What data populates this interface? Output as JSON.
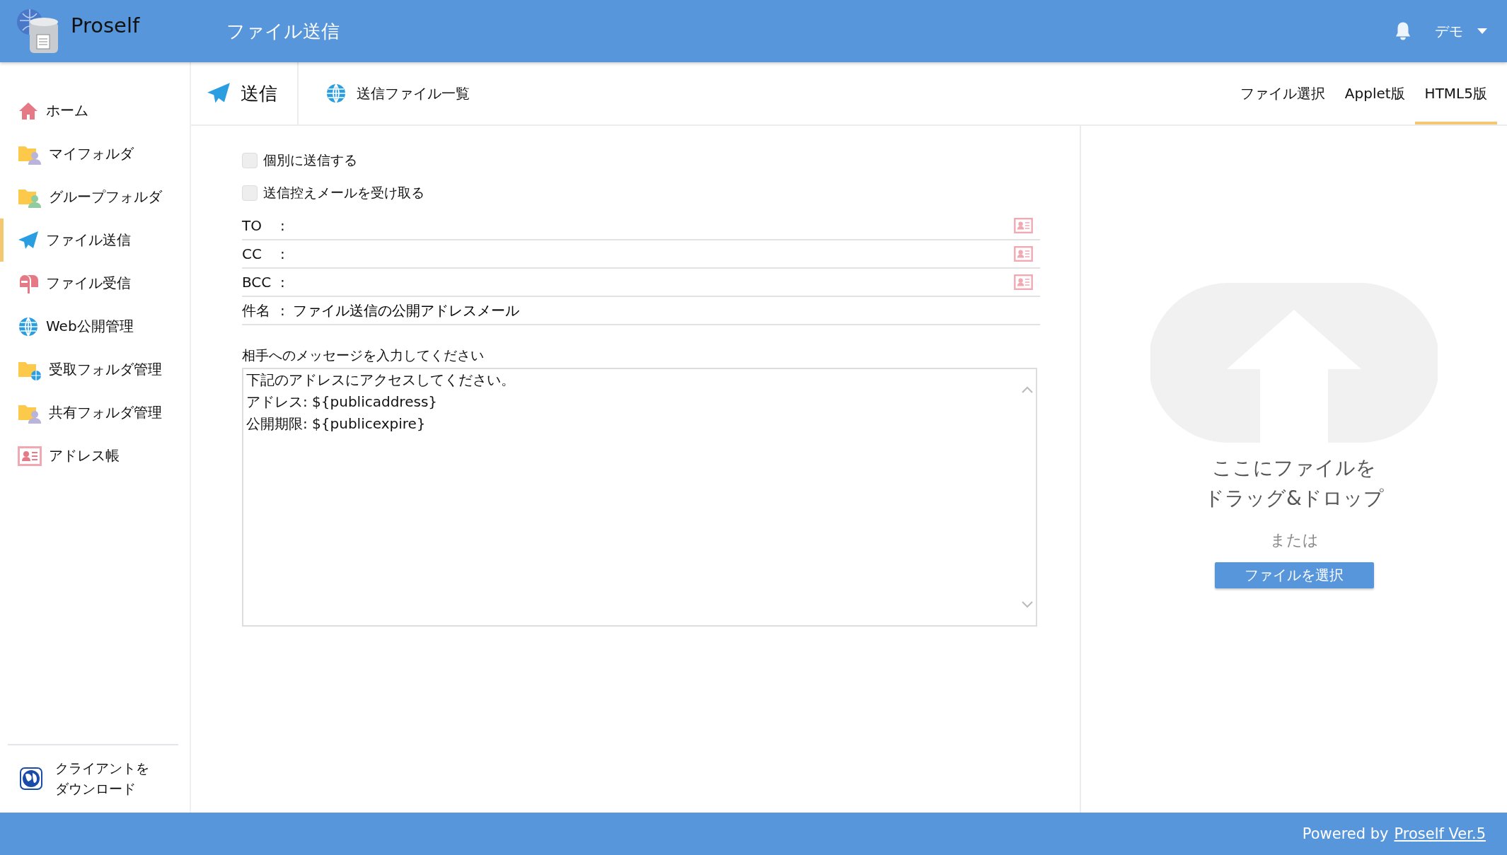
{
  "header": {
    "logo_text": "Proself",
    "title": "ファイル送信",
    "user": "デモ"
  },
  "sidebar": {
    "items": [
      {
        "label": "ホーム",
        "kind": "home",
        "selected": false
      },
      {
        "label": "マイフォルダ",
        "kind": "myfolder",
        "selected": false
      },
      {
        "label": "グループフォルダ",
        "kind": "groupfolder",
        "selected": false
      },
      {
        "label": "ファイル送信",
        "kind": "send",
        "selected": true
      },
      {
        "label": "ファイル受信",
        "kind": "receive",
        "selected": false
      },
      {
        "label": "Web公開管理",
        "kind": "web",
        "selected": false
      },
      {
        "label": "受取フォルダ管理",
        "kind": "receivefolder",
        "selected": false
      },
      {
        "label": "共有フォルダ管理",
        "kind": "sharedfolder",
        "selected": false
      },
      {
        "label": "アドレス帳",
        "kind": "addressbook",
        "selected": false
      }
    ],
    "download": [
      "クライアントを",
      "ダウンロード"
    ]
  },
  "subtabs": [
    {
      "label": "送信",
      "kind": "send",
      "selected": true
    },
    {
      "label": "送信ファイル一覧",
      "kind": "list",
      "selected": false
    }
  ],
  "mode_tabs": [
    {
      "label": "ファイル選択",
      "selected": false
    },
    {
      "label": "Applet版",
      "selected": false
    },
    {
      "label": "HTML5版",
      "selected": true
    }
  ],
  "form": {
    "options": [
      {
        "label": "個別に送信する",
        "checked": false
      },
      {
        "label": "送信控えメールを受け取る",
        "checked": false
      }
    ],
    "recipients": [
      {
        "label": "TO",
        "colon": ":"
      },
      {
        "label": "CC",
        "colon": ":"
      },
      {
        "label": "BCC",
        "colon": ":"
      }
    ],
    "subject": {
      "label": "件名",
      "colon": ":",
      "value": "ファイル送信の公開アドレスメール"
    },
    "message": {
      "label": "相手へのメッセージを入力してください",
      "lines": [
        "下記のアドレスにアクセスしてください。",
        "アドレス: ${publicaddress}",
        "公開期限: ${publicexpire}"
      ]
    }
  },
  "dropzone": {
    "title": [
      "ここにファイルを",
      "ドラッグ&ドロップ"
    ],
    "or": "または",
    "button": "ファイルを選択"
  },
  "footer": {
    "prefix": "Powered by",
    "link": "Proself Ver.5"
  }
}
